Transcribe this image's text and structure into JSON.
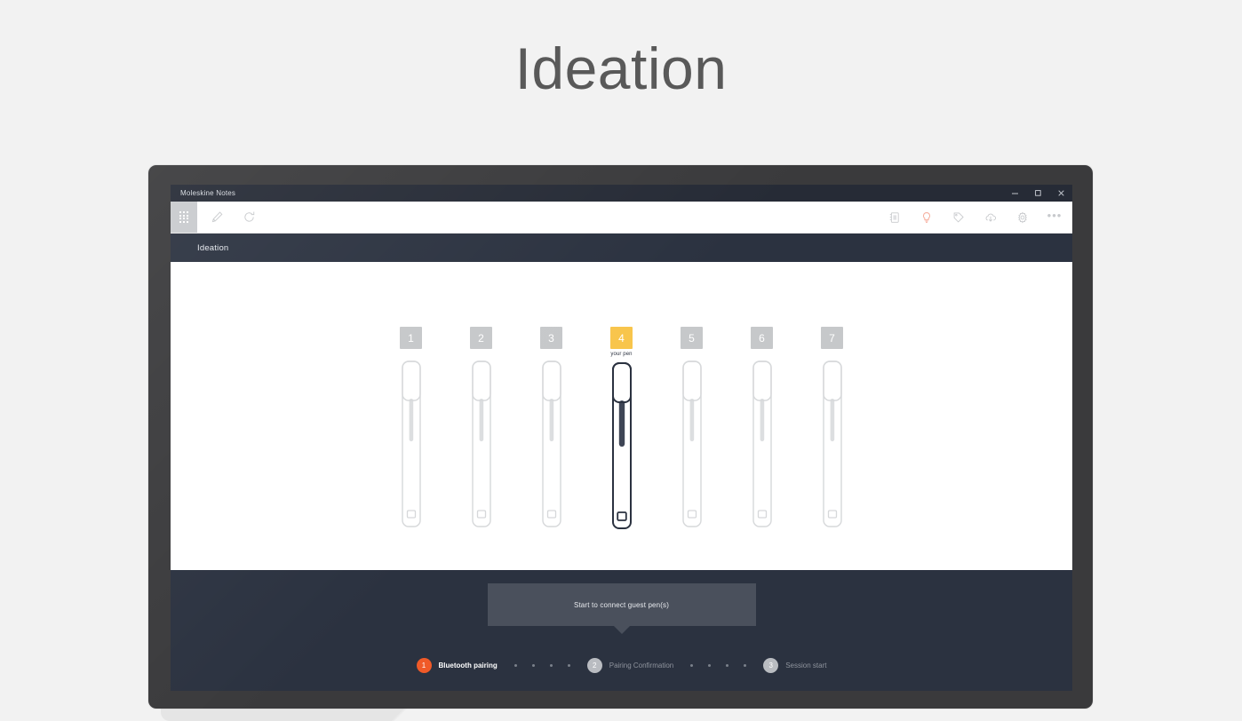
{
  "page": {
    "title": "Ideation",
    "background_color": "#f2f2f2",
    "title_color": "#595959"
  },
  "window": {
    "title": "Moleskine Notes",
    "controls": [
      {
        "name": "minimize",
        "glyph": "minimize-icon"
      },
      {
        "name": "maximize",
        "glyph": "maximize-icon"
      },
      {
        "name": "close",
        "glyph": "close-icon"
      }
    ]
  },
  "toolbar": {
    "grid_icon": "grid-icon",
    "left_icons": [
      {
        "name": "edit-pencil-icon",
        "label": "Edit"
      },
      {
        "name": "refresh-icon",
        "label": "Sync"
      }
    ],
    "right_icons": [
      {
        "name": "notebook-icon",
        "label": "Notebooks",
        "color": "#c7c9cc"
      },
      {
        "name": "lightbulb-icon",
        "label": "Ideas",
        "color": "#f6b0a0"
      },
      {
        "name": "tag-icon",
        "label": "Tags",
        "color": "#c7c9cc"
      },
      {
        "name": "cloud-download-icon",
        "label": "Download",
        "color": "#c7c9cc"
      },
      {
        "name": "gear-icon",
        "label": "Settings",
        "color": "#c7c9cc"
      }
    ],
    "overflow_label": "•••"
  },
  "breadcrumb": {
    "text": "Ideation"
  },
  "pens": {
    "active_index": 3,
    "active_sublabel": "your pen",
    "items": [
      {
        "number": "1",
        "sublabel": "",
        "state": "inactive"
      },
      {
        "number": "2",
        "sublabel": "",
        "state": "inactive"
      },
      {
        "number": "3",
        "sublabel": "",
        "state": "inactive"
      },
      {
        "number": "4",
        "sublabel": "your pen",
        "state": "active"
      },
      {
        "number": "5",
        "sublabel": "",
        "state": "inactive"
      },
      {
        "number": "6",
        "sublabel": "",
        "state": "inactive"
      },
      {
        "number": "7",
        "sublabel": "",
        "state": "inactive"
      }
    ],
    "active_badge_color": "#f8c54c",
    "inactive_badge_color": "#c6c8ca",
    "active_pen_color": "#2b3240",
    "inactive_pen_color": "#d6d8da"
  },
  "footer": {
    "connect_button_label": "Start to connect guest pen(s)",
    "connect_button_color": "#4a505c"
  },
  "stepper": {
    "active_color": "#f05a28",
    "inactive_color": "#b9bcc1",
    "dots_per_gap": 4,
    "steps": [
      {
        "number": "1",
        "label": "Bluetooth pairing",
        "state": "active"
      },
      {
        "number": "2",
        "label": "Pairing Confirmation",
        "state": "inactive"
      },
      {
        "number": "3",
        "label": "Session start",
        "state": "inactive"
      }
    ]
  }
}
